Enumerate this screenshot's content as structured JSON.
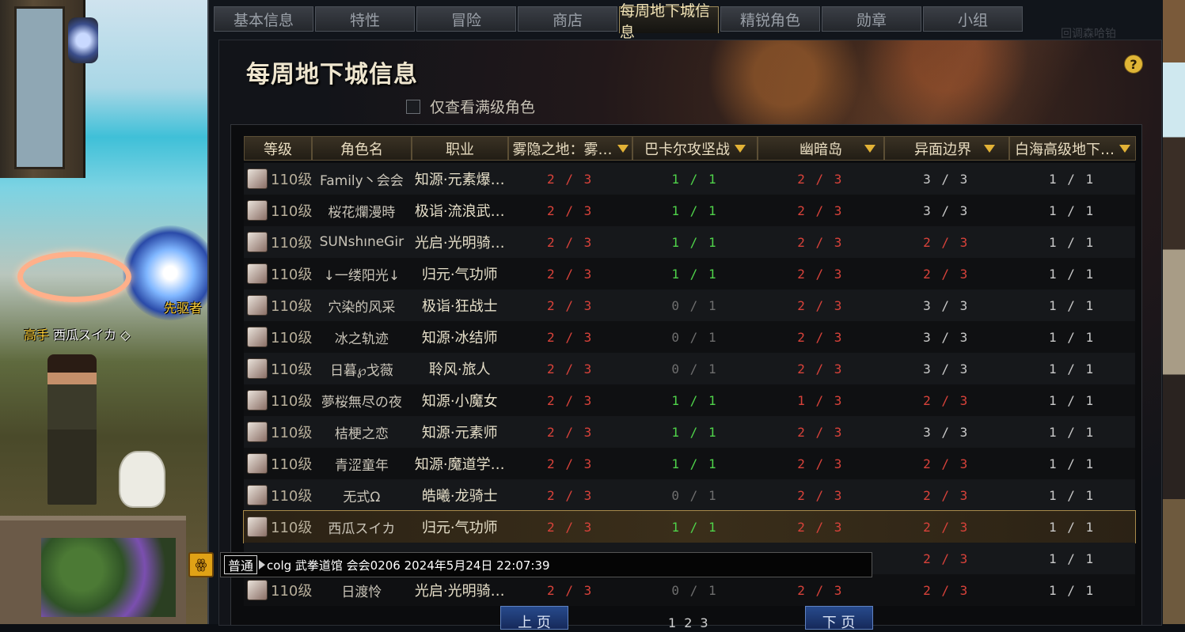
{
  "scene": {
    "vanguard_label": "先驱者",
    "player_rank": "高手",
    "player_name": "西瓜スイカ",
    "player_badge": "◇"
  },
  "tabs": [
    "基本信息",
    "特性",
    "冒险",
    "商店",
    "每周地下城信息",
    "精锐角色",
    "勋章",
    "小组"
  ],
  "active_tab": "每周地下城信息",
  "ghost_text": "回调森哈铂",
  "panel": {
    "title": "每周地下城信息",
    "help_icon": "?",
    "filter_label": "仅查看满级角色"
  },
  "table": {
    "headers": {
      "level": "等级",
      "name": "角色名",
      "job": "职业",
      "d1": "雾隐之地：雾…",
      "d2": "巴卡尔攻坚战",
      "d3": "幽暗岛",
      "d4": "异面边界",
      "d5": "白海高级地下…"
    },
    "rows": [
      {
        "level": "110级",
        "name": "Family丶会会",
        "job": "知源·元素爆…",
        "d1": "2 / 3",
        "d2": "1 / 1",
        "d3": "2 / 3",
        "d4": "3 / 3",
        "d5": "1 / 1",
        "c": [
          "red",
          "green",
          "red",
          "white",
          "white"
        ]
      },
      {
        "level": "110级",
        "name": "桜花爛漫時",
        "job": "极诣·流浪武…",
        "d1": "2 / 3",
        "d2": "1 / 1",
        "d3": "2 / 3",
        "d4": "3 / 3",
        "d5": "1 / 1",
        "c": [
          "red",
          "green",
          "red",
          "white",
          "white"
        ]
      },
      {
        "level": "110级",
        "name": "SUNshıneGir",
        "job": "光启·光明骑…",
        "d1": "2 / 3",
        "d2": "1 / 1",
        "d3": "2 / 3",
        "d4": "2 / 3",
        "d5": "1 / 1",
        "c": [
          "red",
          "green",
          "red",
          "red",
          "white"
        ]
      },
      {
        "level": "110级",
        "name": "↓一缕阳光↓",
        "job": "归元·气功师",
        "d1": "2 / 3",
        "d2": "1 / 1",
        "d3": "2 / 3",
        "d4": "2 / 3",
        "d5": "1 / 1",
        "c": [
          "red",
          "green",
          "red",
          "red",
          "white"
        ]
      },
      {
        "level": "110级",
        "name": "穴染的风采",
        "job": "极诣·狂战士",
        "d1": "2 / 3",
        "d2": "0 / 1",
        "d3": "2 / 3",
        "d4": "3 / 3",
        "d5": "1 / 1",
        "c": [
          "red",
          "gray",
          "red",
          "white",
          "white"
        ]
      },
      {
        "level": "110级",
        "name": "冰之轨迹",
        "job": "知源·冰结师",
        "d1": "2 / 3",
        "d2": "0 / 1",
        "d3": "2 / 3",
        "d4": "3 / 3",
        "d5": "1 / 1",
        "c": [
          "red",
          "gray",
          "red",
          "white",
          "white"
        ]
      },
      {
        "level": "110级",
        "name": "日暮℘戈薇",
        "job": "聆风·旅人",
        "d1": "2 / 3",
        "d2": "0 / 1",
        "d3": "2 / 3",
        "d4": "3 / 3",
        "d5": "1 / 1",
        "c": [
          "red",
          "gray",
          "red",
          "white",
          "white"
        ]
      },
      {
        "level": "110级",
        "name": "夢桜無尽の夜",
        "job": "知源·小魔女",
        "d1": "2 / 3",
        "d2": "1 / 1",
        "d3": "1 / 3",
        "d4": "2 / 3",
        "d5": "1 / 1",
        "c": [
          "red",
          "green",
          "red",
          "red",
          "white"
        ]
      },
      {
        "level": "110级",
        "name": "桔梗之恋",
        "job": "知源·元素师",
        "d1": "2 / 3",
        "d2": "1 / 1",
        "d3": "2 / 3",
        "d4": "3 / 3",
        "d5": "1 / 1",
        "c": [
          "red",
          "green",
          "red",
          "white",
          "white"
        ]
      },
      {
        "level": "110级",
        "name": "青涩童年",
        "job": "知源·魔道学…",
        "d1": "2 / 3",
        "d2": "1 / 1",
        "d3": "2 / 3",
        "d4": "2 / 3",
        "d5": "1 / 1",
        "c": [
          "red",
          "green",
          "red",
          "red",
          "white"
        ]
      },
      {
        "level": "110级",
        "name": "无式Ω",
        "job": "皓曦·龙骑士",
        "d1": "2 / 3",
        "d2": "0 / 1",
        "d3": "2 / 3",
        "d4": "2 / 3",
        "d5": "1 / 1",
        "c": [
          "red",
          "gray",
          "red",
          "red",
          "white"
        ]
      },
      {
        "level": "110级",
        "name": "西瓜スイカ",
        "job": "归元·气功师",
        "d1": "2 / 3",
        "d2": "1 / 1",
        "d3": "2 / 3",
        "d4": "2 / 3",
        "d5": "1 / 1",
        "c": [
          "red",
          "green",
          "red",
          "red",
          "white"
        ],
        "highlight": true
      },
      {
        "level": "",
        "name": "",
        "job": "",
        "d1": "",
        "d2": "",
        "d3": "",
        "d4": "2 / 3",
        "d5": "1 / 1",
        "c": [
          "red",
          "green",
          "red",
          "red",
          "white"
        ]
      },
      {
        "level": "110级",
        "name": "日渡怜",
        "job": "光启·光明骑…",
        "d1": "2 / 3",
        "d2": "0 / 1",
        "d3": "2 / 3",
        "d4": "2 / 3",
        "d5": "1 / 1",
        "c": [
          "red",
          "gray",
          "red",
          "red",
          "white"
        ]
      }
    ]
  },
  "chat": {
    "emote": "ꙮ",
    "channel": "普通",
    "message": "colg 武拳道馆 会会0206 2024年5月24日 22:07:39"
  },
  "pager": {
    "prev": "上 页",
    "next": "下 页",
    "pages": [
      "1",
      "2",
      "3"
    ]
  },
  "colors": {
    "red": "#d8423a",
    "green": "#4fd34a",
    "gold": "#e2b236"
  }
}
